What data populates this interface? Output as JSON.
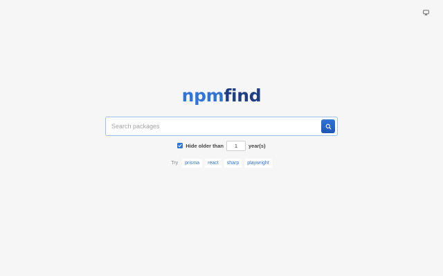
{
  "logo": {
    "part_a": "npm",
    "part_b": "find"
  },
  "search": {
    "placeholder": "Search packages",
    "value": ""
  },
  "filter": {
    "checked": true,
    "label": "Hide older than",
    "value": "1",
    "unit": "year(s)"
  },
  "suggestions": {
    "label": "Try",
    "items": [
      "prisma",
      "react",
      "sharp",
      "playwright"
    ]
  },
  "colors": {
    "accent": "#2f74d6",
    "dark": "#1f3d82",
    "background": "#f6f6f6"
  },
  "icons": {
    "theme_toggle": "monitor-icon",
    "search": "search-icon",
    "checkbox": "check-icon"
  }
}
